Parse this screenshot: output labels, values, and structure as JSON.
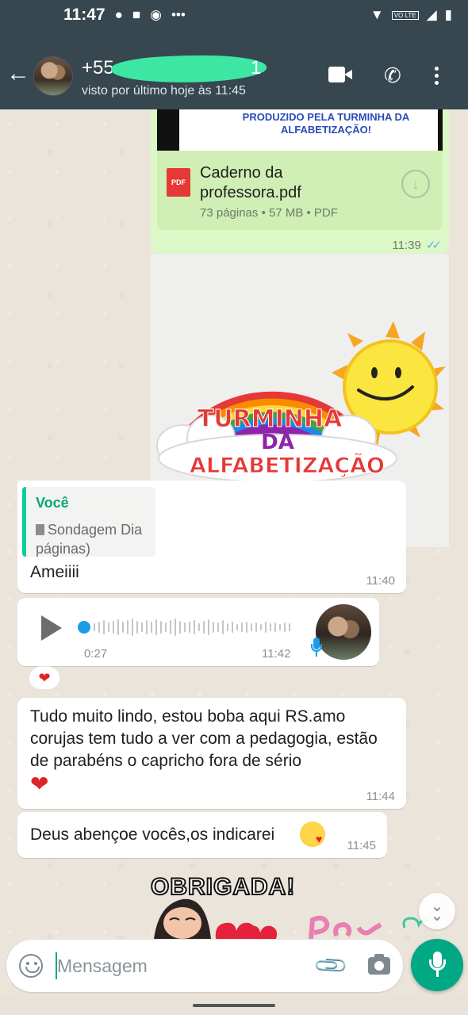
{
  "status_bar": {
    "time": "11:47",
    "network_badge": "VO LTE"
  },
  "header": {
    "contact_prefix": "+55",
    "contact_suffix": "1",
    "last_seen": "visto por último hoje às 11:45"
  },
  "messages": {
    "doc_preview_text": "PRODUZIDO PELA TURMINHA DA ALFABETIZAÇÃO!",
    "doc_name": "Caderno da professora.pdf",
    "doc_meta": "73 páginas • 57 MB • PDF",
    "doc_icon_text": "PDF",
    "doc_time": "11:39",
    "sticker_line1": "TURMINHA",
    "sticker_line2": "DA",
    "sticker_line3": "ALFABETIZAÇÃO",
    "quote_author": "Você",
    "quote_text_line1": "Sondagem Dia",
    "quote_text_line2": "páginas)",
    "reply_text": "Ameiiii",
    "reply_time": "11:40",
    "audio_duration": "0:27",
    "audio_time": "11:42",
    "reaction": "❤",
    "long_text": "Tudo muito lindo, estou boba aqui RS.amo corujas tem tudo a ver com a pedagogia, estão de parabéns o capricho fora de sério",
    "long_heart": "❤",
    "long_time": "11:44",
    "bless_text": "Deus abençoe vocês,os indicarei",
    "bless_time": "11:45",
    "thanks_sticker_text": "OBRIGADA!"
  },
  "composer": {
    "placeholder": "Mensagem"
  },
  "icons": {
    "back": "back-arrow-icon",
    "video": "video-call-icon",
    "call": "phone-icon",
    "menu": "more-vert-icon",
    "emoji": "emoji-icon",
    "attach": "paperclip-icon",
    "camera": "camera-icon",
    "mic": "microphone-icon",
    "download": "download-icon",
    "scroll_down": "double-chevron-down-icon"
  },
  "colors": {
    "header": "#36474f",
    "outgoing_bubble": "#dcf8c6",
    "accent": "#00a884",
    "read_ticks": "#4fb6ec",
    "audio_progress": "#1b9ce8"
  }
}
